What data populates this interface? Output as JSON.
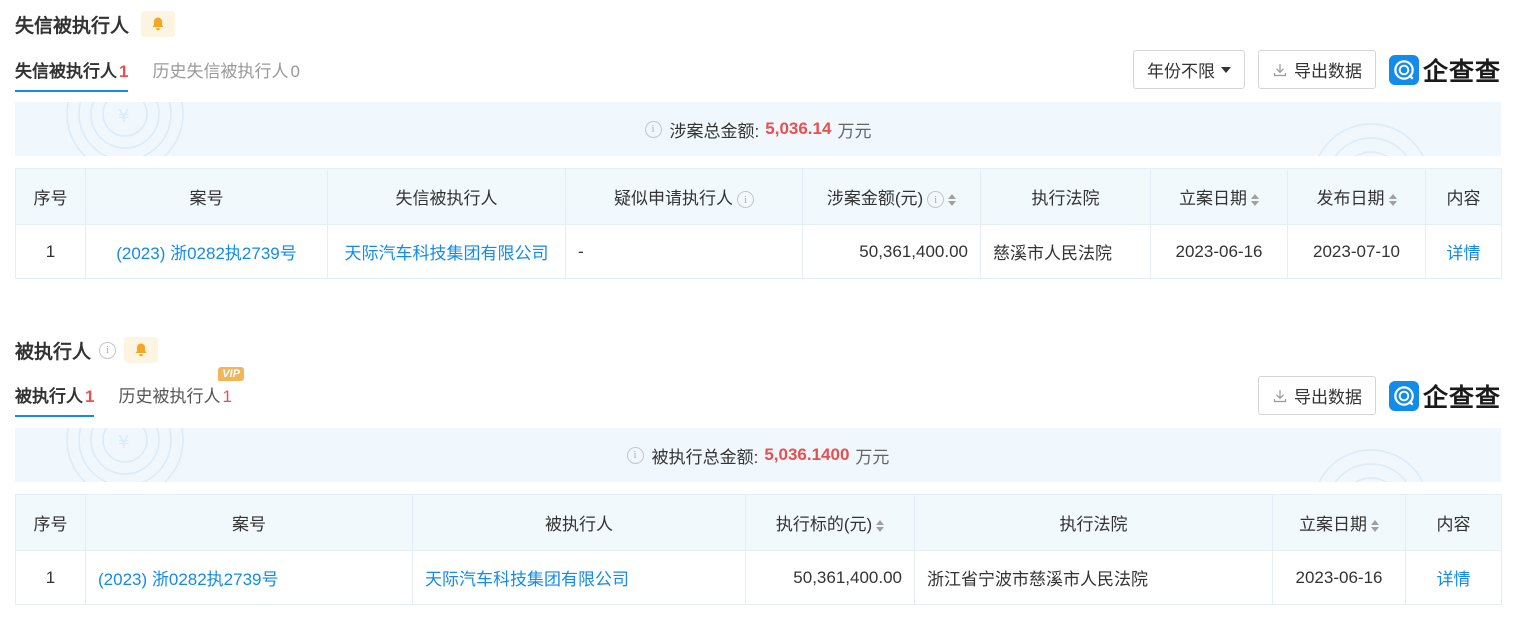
{
  "section1": {
    "title": "失信被执行人",
    "tabs": [
      {
        "label": "失信被执行人",
        "count": "1"
      },
      {
        "label": "历史失信被执行人",
        "count": "0"
      }
    ],
    "year_filter": "年份不限",
    "export_label": "导出数据",
    "logo_text": "企查查",
    "summary_label": "涉案总金额:",
    "summary_amount": "5,036.14",
    "summary_unit": "万元",
    "headers": [
      "序号",
      "案号",
      "失信被执行人",
      "疑似申请执行人",
      "涉案金额(元)",
      "执行法院",
      "立案日期",
      "发布日期",
      "内容"
    ],
    "rows": [
      {
        "index": "1",
        "case_no": "(2023) 浙0282执2739号",
        "party": "天际汽车科技集团有限公司",
        "applicant": "-",
        "amount": "50,361,400.00",
        "court": "慈溪市人民法院",
        "filing_date": "2023-06-16",
        "publish_date": "2023-07-10",
        "detail": "详情"
      }
    ]
  },
  "section2": {
    "title": "被执行人",
    "tabs": [
      {
        "label": "被执行人",
        "count": "1"
      },
      {
        "label": "历史被执行人",
        "count": "1",
        "badge": "VIP"
      }
    ],
    "export_label": "导出数据",
    "logo_text": "企查查",
    "summary_label": "被执行总金额:",
    "summary_amount": "5,036.1400",
    "summary_unit": "万元",
    "headers": [
      "序号",
      "案号",
      "被执行人",
      "执行标的(元)",
      "执行法院",
      "立案日期",
      "内容"
    ],
    "rows": [
      {
        "index": "1",
        "case_no": "(2023) 浙0282执2739号",
        "party": "天际汽车科技集团有限公司",
        "amount": "50,361,400.00",
        "court": "浙江省宁波市慈溪市人民法院",
        "filing_date": "2023-06-16",
        "detail": "详情"
      }
    ]
  },
  "colors": {
    "accent": "#128bed",
    "amount_red": "#e8504f",
    "summary_bg": "#f0f7fd",
    "bell_bg": "#fdf4e2",
    "bell": "#f5a623",
    "vip": "#f3b559"
  }
}
